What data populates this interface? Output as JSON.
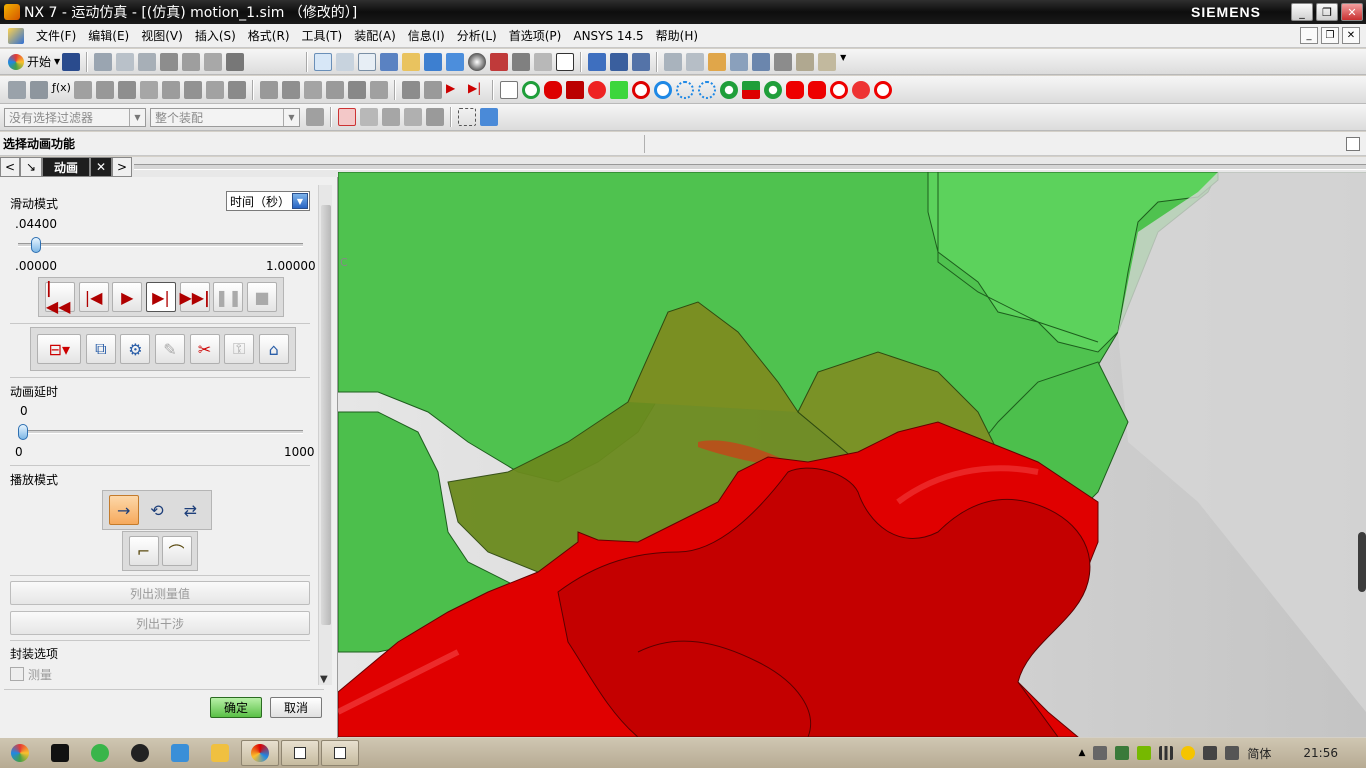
{
  "window": {
    "title": "NX 7 - 运动仿真 - [(仿真) motion_1.sim （修改的）]",
    "brand": "SIEMENS",
    "controls": [
      "minimize",
      "restore",
      "close"
    ]
  },
  "menu": {
    "items": [
      "文件(F)",
      "编辑(E)",
      "视图(V)",
      "插入(S)",
      "格式(R)",
      "工具(T)",
      "装配(A)",
      "信息(I)",
      "分析(L)",
      "首选项(P)",
      "ANSYS 14.5",
      "帮助(H)"
    ]
  },
  "toolbar": {
    "start_label": "开始",
    "filter_placeholder": "没有选择过滤器",
    "scope_placeholder": "整个装配"
  },
  "prompt": {
    "text": "选择动画功能"
  },
  "resource_bar": {
    "active_tab": "动画"
  },
  "dialog": {
    "slide_mode_label": "滑动模式",
    "slide_mode_value": "时间（秒）",
    "slider_current": ".04400",
    "slider_min": ".00000",
    "slider_max": "1.00000",
    "slider_fraction": 0.044,
    "delay_label": "动画延时",
    "delay_current": "0",
    "delay_min": "0",
    "delay_max": "1000",
    "delay_fraction": 0.0,
    "playback_label": "播放模式",
    "list_measure_label": "列出测量值",
    "list_interference_label": "列出干涉",
    "package_label": "封装选项",
    "measure_label": "测量",
    "ok_label": "确定",
    "cancel_label": "取消"
  },
  "taskbar": {
    "language": "简体",
    "clock": "21:56"
  },
  "colors": {
    "gear_green": "#4fc24f",
    "gear_red": "#e00000",
    "contact_mark": "#b5531b",
    "ok_button": "#5ac046"
  }
}
